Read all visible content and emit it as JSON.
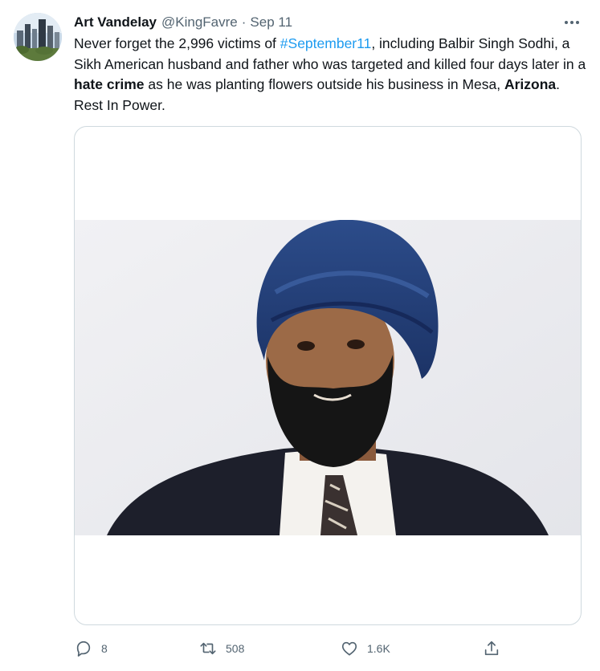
{
  "tweet": {
    "author": {
      "name": "Art Vandelay",
      "handle": "@KingFavre",
      "avatar_icon": "city-skyline-avatar"
    },
    "separator": "·",
    "date": "Sep 11",
    "more_icon": "more-dots-icon",
    "text": {
      "part1": "Never forget the 2,996 victims of ",
      "hashtag": "#September11",
      "part2": ", including Balbir Singh Sodhi, a Sikh American husband and father who was targeted and killed four days later in a ",
      "bold1": "hate crime",
      "part3": " as he was planting flowers outside his business in Mesa, ",
      "bold2": "Arizona",
      "part4": ". Rest In Power."
    },
    "media": {
      "icon": "portrait-photo"
    },
    "actions": {
      "reply": {
        "icon": "reply-icon",
        "count": "8"
      },
      "retweet": {
        "icon": "retweet-icon",
        "count": "508"
      },
      "like": {
        "icon": "like-icon",
        "count": "1.6K"
      },
      "share": {
        "icon": "share-icon"
      }
    },
    "colors": {
      "text": "#0f1419",
      "secondary": "#536471",
      "link": "#1d9bf0",
      "border": "#cfd9de"
    }
  }
}
